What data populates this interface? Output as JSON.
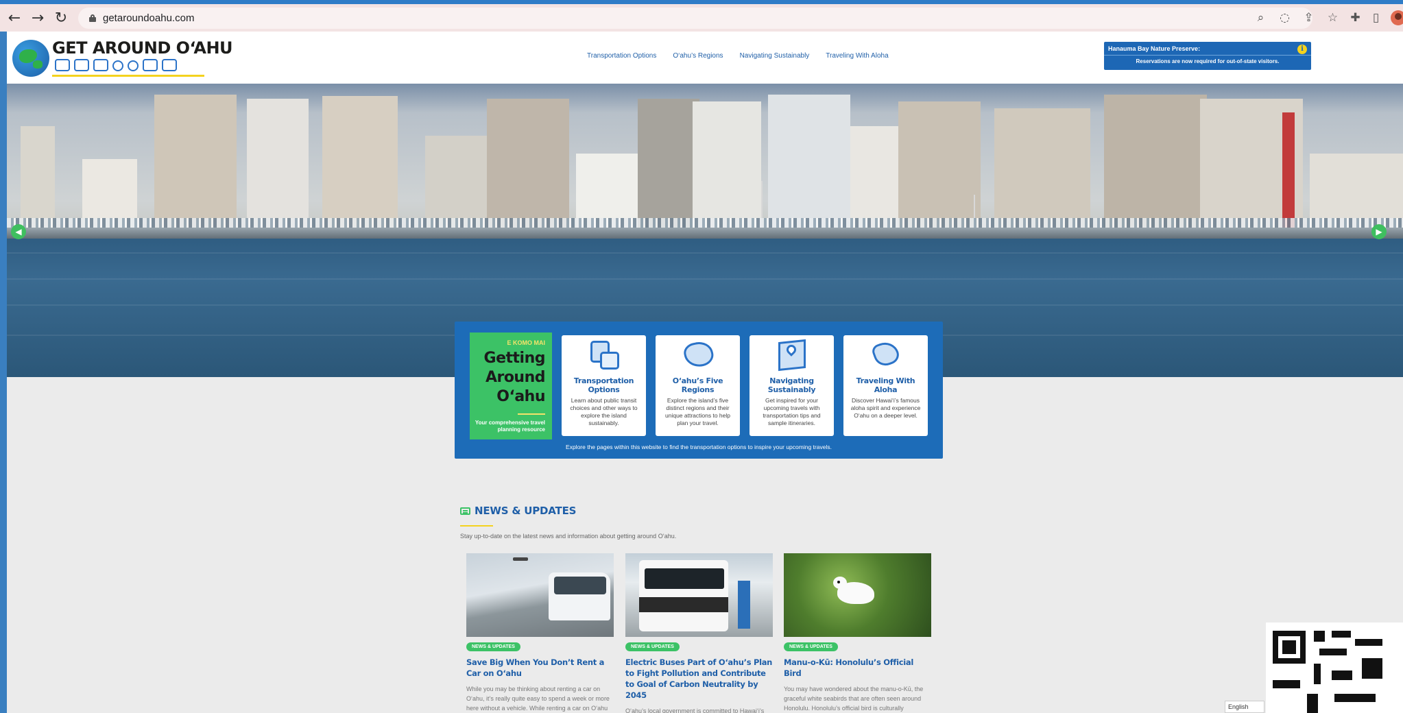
{
  "browser": {
    "url": "getaroundoahu.com"
  },
  "header": {
    "logo_text": "GET AROUND O‘AHU",
    "nav": [
      {
        "label": "Transportation Options"
      },
      {
        "label": "O‘ahu’s Regions"
      },
      {
        "label": "Navigating Sustainably"
      },
      {
        "label": "Traveling With Aloha"
      }
    ],
    "alert": {
      "title": "Hanauma Bay Nature Preserve:",
      "body": "Reservations are now required for out-of-state visitors."
    }
  },
  "feature": {
    "kicker": "E KOMO MAI",
    "title": "Getting Around O‘ahu",
    "subtitle": "Your comprehensive travel planning resource",
    "cards": [
      {
        "title": "Transportation Options",
        "desc": "Learn about public transit choices and other ways to explore the island sustainably.",
        "icon": "buses-icon"
      },
      {
        "title": "O‘ahu’s Five Regions",
        "desc": "Explore the island’s five distinct regions and their unique attractions to help plan your travel.",
        "icon": "island-map-icon"
      },
      {
        "title": "Navigating Sustainably",
        "desc": "Get inspired for your upcoming travels with transportation tips and sample itineraries.",
        "icon": "map-pin-icon"
      },
      {
        "title": "Traveling With Aloha",
        "desc": "Discover Hawai‘i’s famous aloha spirit and experience O‘ahu on a deeper level.",
        "icon": "shaka-icon"
      }
    ],
    "footer": "Explore the pages within this website to find the transportation options to inspire your upcoming travels."
  },
  "news": {
    "title": "NEWS & UPDATES",
    "subtitle": "Stay up-to-date on the latest news and information about getting around O‘ahu.",
    "posts": [
      {
        "badge": "NEWS & UPDATES",
        "title": "Save Big When You Don’t Rent a Car on O‘ahu",
        "excerpt": "While you may be thinking about renting a car on O‘ahu, it’s really quite easy to spend a week or more here without a vehicle. While renting a car on O‘ahu"
      },
      {
        "badge": "NEWS & UPDATES",
        "title": "Electric Buses Part of O‘ahu’s Plan to Fight Pollution and Contribute to Goal of Carbon Neutrality by 2045",
        "excerpt": "O‘ahu’s local government is committed to Hawai‘i’s plans to fight carbon pollution. The City & County of"
      },
      {
        "badge": "NEWS & UPDATES",
        "title": "Manu-o-Kū: Honolulu’s Official Bird",
        "excerpt": "You may have wondered about the manu-o-Kū, the graceful white seabirds that are often seen around Honolulu. Honolulu’s official bird is culturally significant to Native Hawaiians, intrepid ocean"
      }
    ]
  },
  "language": "English",
  "colors": {
    "brand_blue": "#1d6cb8",
    "brand_green": "#3cc266",
    "accent_yellow": "#f4d21e"
  }
}
